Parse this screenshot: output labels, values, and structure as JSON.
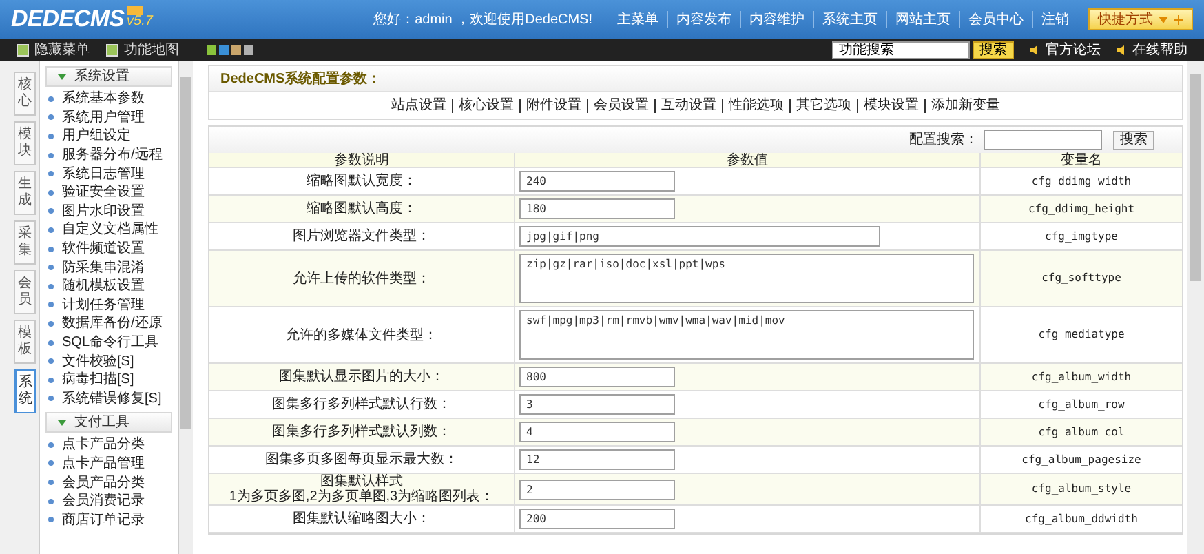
{
  "header": {
    "logo": "DEDECMS",
    "version": "v5.7",
    "greeting": "您好：admin ，欢迎使用DedeCMS!",
    "links": [
      "主菜单",
      "内容发布",
      "内容维护",
      "系统主页",
      "网站主页",
      "会员中心",
      "注销"
    ],
    "shortcut": "快捷方式"
  },
  "toolbar": {
    "buttons": [
      "隐藏菜单",
      "功能地图"
    ],
    "skins": [
      {
        "color": "#8ac33c"
      },
      {
        "color": "#3a8fd6"
      },
      {
        "color": "#c9a56b"
      },
      {
        "color": "#b0b0b0"
      }
    ],
    "search": {
      "value": "功能搜索",
      "button": "搜索"
    },
    "links": [
      "官方论坛",
      "在线帮助"
    ]
  },
  "side_tabs": [
    {
      "label": "核心",
      "selected": false
    },
    {
      "label": "模块",
      "selected": false
    },
    {
      "label": "生成",
      "selected": false
    },
    {
      "label": "采集",
      "selected": false
    },
    {
      "label": "会员",
      "selected": false
    },
    {
      "label": "模板",
      "selected": false
    },
    {
      "label": "系统",
      "selected": true
    }
  ],
  "menu": [
    {
      "title": "系统设置",
      "expanded": true,
      "items": [
        "系统基本参数",
        "系统用户管理",
        "用户组设定",
        "服务器分布/远程",
        "系统日志管理",
        "验证安全设置",
        "图片水印设置",
        "自定义文档属性",
        "软件频道设置",
        "防采集串混淆",
        "随机模板设置",
        "计划任务管理",
        "数据库备份/还原",
        "SQL命令行工具",
        "文件校验[S]",
        "病毒扫描[S]",
        "系统错误修复[S]"
      ]
    },
    {
      "title": "支付工具",
      "expanded": true,
      "items": [
        "点卡产品分类",
        "点卡产品管理",
        "会员产品分类",
        "会员消费记录",
        "商店订单记录"
      ]
    }
  ],
  "panel": {
    "title": "DedeCMS系统配置参数：",
    "tabs": [
      "站点设置",
      "核心设置",
      "附件设置",
      "会员设置",
      "互动设置",
      "性能选项",
      "其它选项",
      "模块设置",
      "添加新变量"
    ],
    "search_label": "配置搜索：",
    "search_button": "搜索"
  },
  "table": {
    "columns": [
      "参数说明",
      "参数值",
      "变量名"
    ],
    "rows": [
      {
        "label": "缩略图默认宽度：",
        "value": "240",
        "var": "cfg_ddimg_width",
        "kind": "short"
      },
      {
        "label": "缩略图默认高度：",
        "value": "180",
        "var": "cfg_ddimg_height",
        "kind": "short"
      },
      {
        "label": "图片浏览器文件类型：",
        "value": "jpg|gif|png",
        "var": "cfg_imgtype",
        "kind": "long"
      },
      {
        "label": "允许上传的软件类型：",
        "value": "zip|gz|rar|iso|doc|xsl|ppt|wps",
        "var": "cfg_softtype",
        "kind": "textarea"
      },
      {
        "label": "允许的多媒体文件类型：",
        "value": "swf|mpg|mp3|rm|rmvb|wmv|wma|wav|mid|mov",
        "var": "cfg_mediatype",
        "kind": "textarea"
      },
      {
        "label": "图集默认显示图片的大小：",
        "value": "800",
        "var": "cfg_album_width",
        "kind": "short"
      },
      {
        "label": "图集多行多列样式默认行数：",
        "value": "3",
        "var": "cfg_album_row",
        "kind": "short"
      },
      {
        "label": "图集多行多列样式默认列数：",
        "value": "4",
        "var": "cfg_album_col",
        "kind": "short"
      },
      {
        "label": "图集多页多图每页显示最大数：",
        "value": "12",
        "var": "cfg_album_pagesize",
        "kind": "short"
      },
      {
        "label": "图集默认样式\n1为多页多图,2为多页单图,3为缩略图列表：",
        "value": "2",
        "var": "cfg_album_style",
        "kind": "short"
      },
      {
        "label": "图集默认缩略图大小：",
        "value": "200",
        "var": "cfg_album_ddwidth",
        "kind": "short"
      }
    ]
  }
}
